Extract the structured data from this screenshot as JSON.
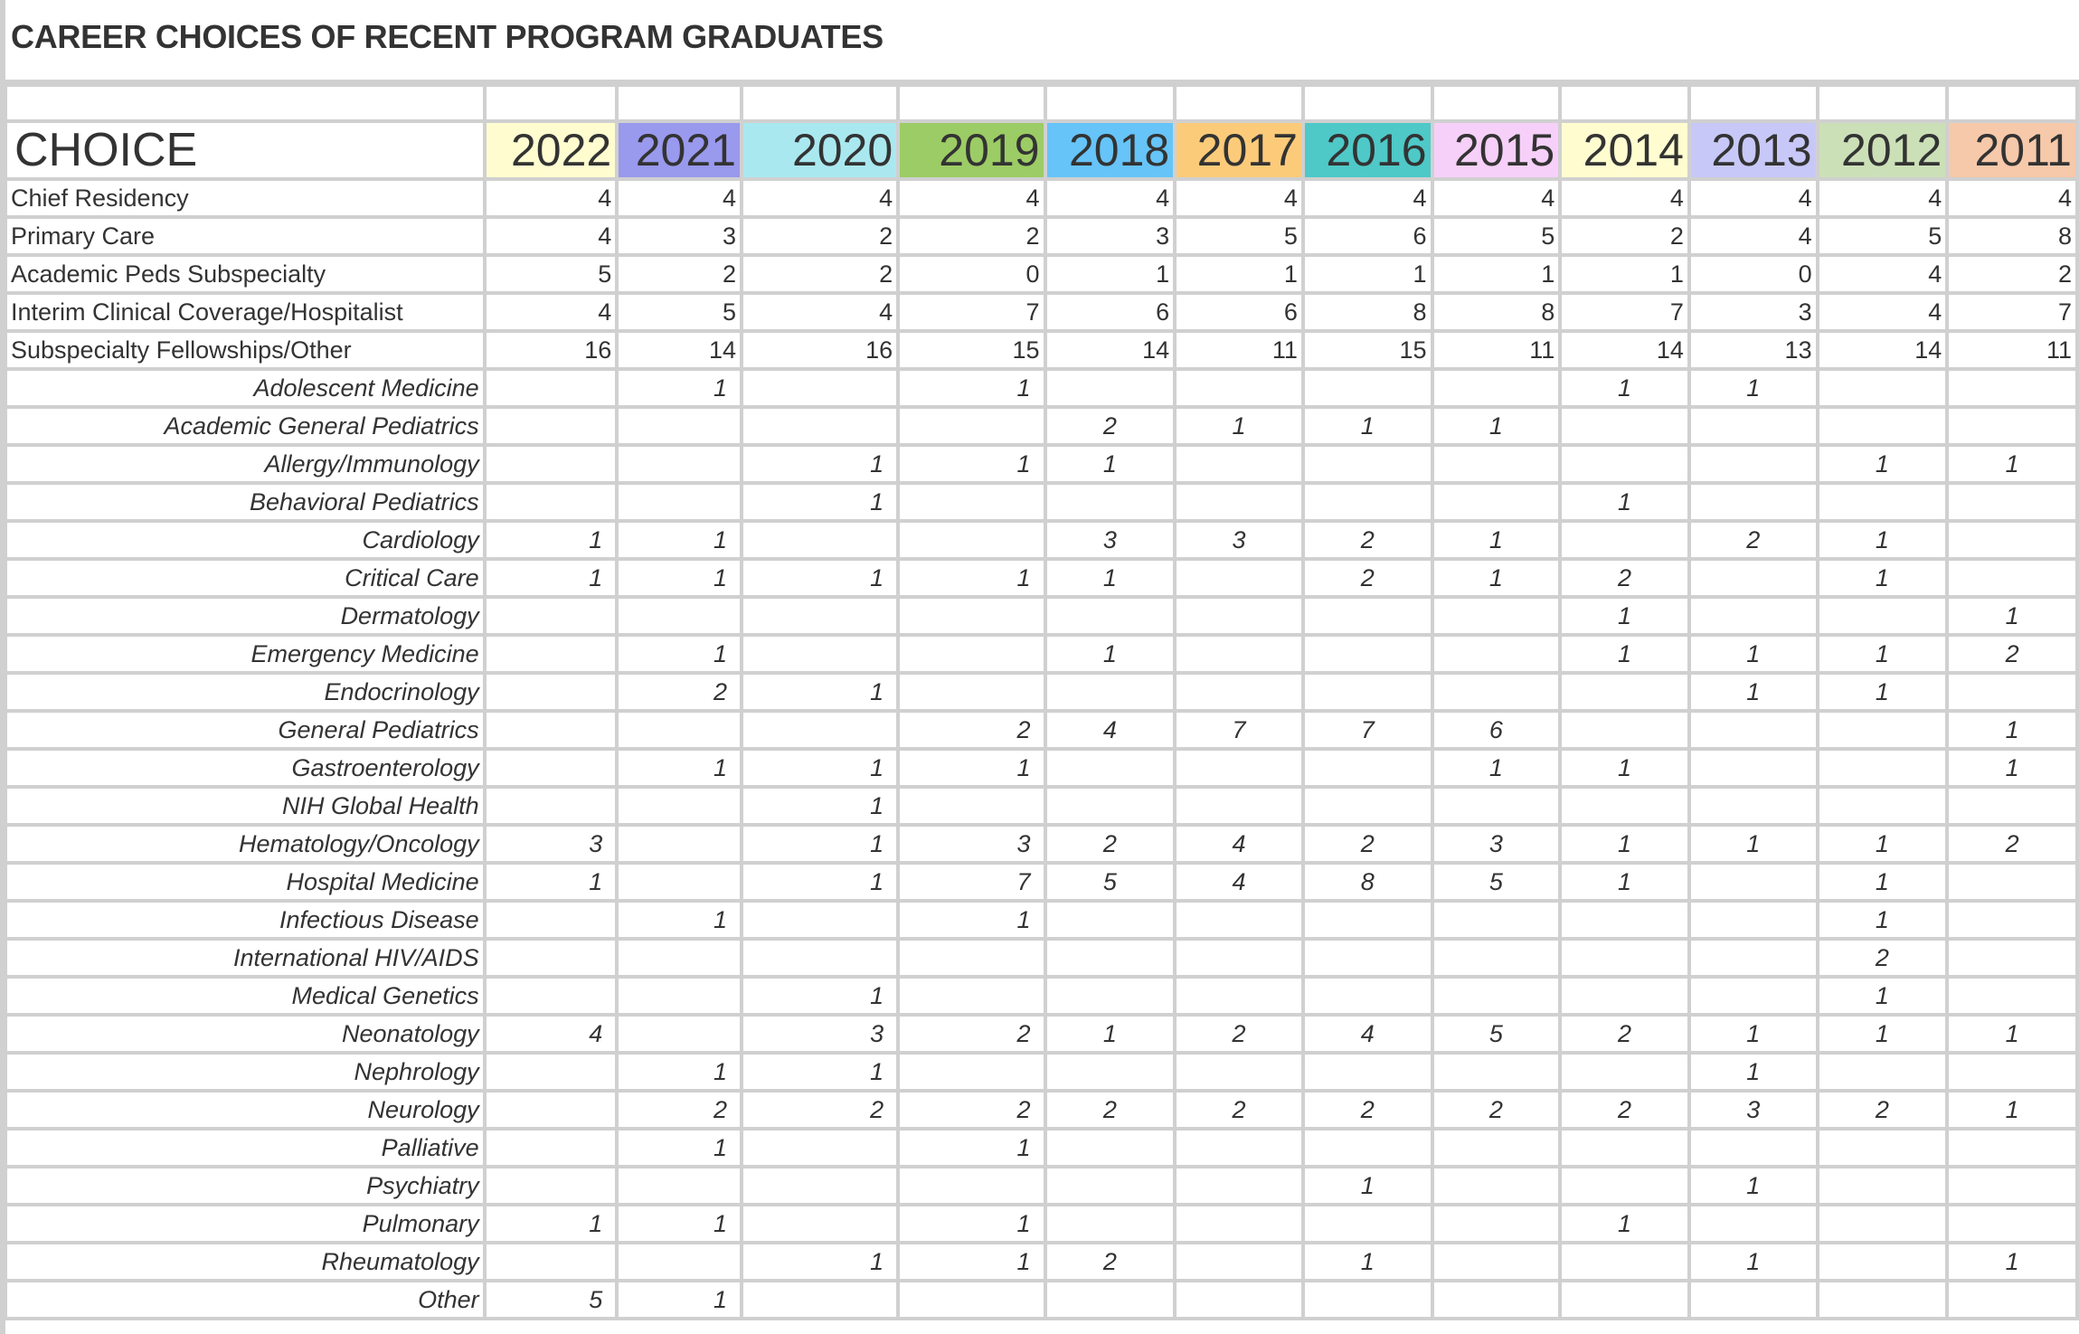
{
  "title": "CAREER CHOICES OF RECENT PROGRAM GRADUATES",
  "header": {
    "choice_label": "CHOICE",
    "years": [
      {
        "label": "2022",
        "color": "#fffdd0"
      },
      {
        "label": "2021",
        "color": "#9999ee"
      },
      {
        "label": "2020",
        "color": "#aae8f0"
      },
      {
        "label": "2019",
        "color": "#9ccc65"
      },
      {
        "label": "2018",
        "color": "#66c4f8"
      },
      {
        "label": "2017",
        "color": "#fccb7a"
      },
      {
        "label": "2016",
        "color": "#4fc8c8"
      },
      {
        "label": "2015",
        "color": "#f6d0f8"
      },
      {
        "label": "2014",
        "color": "#fffdd0"
      },
      {
        "label": "2013",
        "color": "#c8c8f8"
      },
      {
        "label": "2012",
        "color": "#cce0b8"
      },
      {
        "label": "2011",
        "color": "#f6c9aa"
      }
    ]
  },
  "main_rows": [
    {
      "label": "Chief Residency",
      "values": [
        "4",
        "4",
        "4",
        "4",
        "4",
        "4",
        "4",
        "4",
        "4",
        "4",
        "4",
        "4"
      ]
    },
    {
      "label": "Primary Care",
      "values": [
        "4",
        "3",
        "2",
        "2",
        "3",
        "5",
        "6",
        "5",
        "2",
        "4",
        "5",
        "8"
      ]
    },
    {
      "label": "Academic Peds Subspecialty",
      "values": [
        "5",
        "2",
        "2",
        "0",
        "1",
        "1",
        "1",
        "1",
        "1",
        "0",
        "4",
        "2"
      ]
    },
    {
      "label": "Interim Clinical Coverage/Hospitalist",
      "values": [
        "4",
        "5",
        "4",
        "7",
        "6",
        "6",
        "8",
        "8",
        "7",
        "3",
        "4",
        "7"
      ]
    },
    {
      "label": "Subspecialty Fellowships/Other",
      "values": [
        "16",
        "14",
        "16",
        "15",
        "14",
        "11",
        "15",
        "11",
        "14",
        "13",
        "14",
        "11"
      ]
    }
  ],
  "sub_rows": [
    {
      "label": "Adolescent Medicine",
      "values": [
        "",
        "1",
        "",
        "1",
        "",
        "",
        "",
        "",
        "1",
        "1",
        "",
        ""
      ]
    },
    {
      "label": "Academic General Pediatrics",
      "values": [
        "",
        "",
        "",
        "",
        "2",
        "1",
        "1",
        "1",
        "",
        "",
        "",
        ""
      ]
    },
    {
      "label": "Allergy/Immunology",
      "values": [
        "",
        "",
        "1",
        "1",
        "1",
        "",
        "",
        "",
        "",
        "",
        "1",
        "1"
      ]
    },
    {
      "label": "Behavioral Pediatrics",
      "values": [
        "",
        "",
        "1",
        "",
        "",
        "",
        "",
        "",
        "1",
        "",
        "",
        ""
      ]
    },
    {
      "label": "Cardiology",
      "values": [
        "1",
        "1",
        "",
        "",
        "3",
        "3",
        "2",
        "1",
        "",
        "2",
        "1",
        ""
      ]
    },
    {
      "label": "Critical Care",
      "values": [
        "1",
        "1",
        "1",
        "1",
        "1",
        "",
        "2",
        "1",
        "2",
        "",
        "1",
        ""
      ]
    },
    {
      "label": "Dermatology",
      "values": [
        "",
        "",
        "",
        "",
        "",
        "",
        "",
        "",
        "1",
        "",
        "",
        "1"
      ]
    },
    {
      "label": "Emergency Medicine",
      "values": [
        "",
        "1",
        "",
        "",
        "1",
        "",
        "",
        "",
        "1",
        "1",
        "1",
        "2"
      ]
    },
    {
      "label": "Endocrinology",
      "values": [
        "",
        "2",
        "1",
        "",
        "",
        "",
        "",
        "",
        "",
        "1",
        "1",
        ""
      ]
    },
    {
      "label": "General Pediatrics",
      "values": [
        "",
        "",
        "",
        "2",
        "4",
        "7",
        "7",
        "6",
        "",
        "",
        "",
        "1"
      ]
    },
    {
      "label": "Gastroenterology",
      "values": [
        "",
        "1",
        "1",
        "1",
        "",
        "",
        "",
        "1",
        "1",
        "",
        "",
        "1"
      ]
    },
    {
      "label": "NIH Global Health",
      "values": [
        "",
        "",
        "1",
        "",
        "",
        "",
        "",
        "",
        "",
        "",
        "",
        ""
      ]
    },
    {
      "label": "Hematology/Oncology",
      "values": [
        "3",
        "",
        "1",
        "3",
        "2",
        "4",
        "2",
        "3",
        "1",
        "1",
        "1",
        "2"
      ]
    },
    {
      "label": "Hospital Medicine",
      "values": [
        "1",
        "",
        "1",
        "7",
        "5",
        "4",
        "8",
        "5",
        "1",
        "",
        "1",
        ""
      ]
    },
    {
      "label": "Infectious Disease",
      "values": [
        "",
        "1",
        "",
        "1",
        "",
        "",
        "",
        "",
        "",
        "",
        "1",
        ""
      ]
    },
    {
      "label": "International HIV/AIDS",
      "values": [
        "",
        "",
        "",
        "",
        "",
        "",
        "",
        "",
        "",
        "",
        "2",
        ""
      ]
    },
    {
      "label": "Medical Genetics",
      "values": [
        "",
        "",
        "1",
        "",
        "",
        "",
        "",
        "",
        "",
        "",
        "1",
        ""
      ]
    },
    {
      "label": "Neonatology",
      "values": [
        "4",
        "",
        "3",
        "2",
        "1",
        "2",
        "4",
        "5",
        "2",
        "1",
        "1",
        "1"
      ]
    },
    {
      "label": "Nephrology",
      "values": [
        "",
        "1",
        "1",
        "",
        "",
        "",
        "",
        "",
        "",
        "1",
        "",
        ""
      ]
    },
    {
      "label": "Neurology",
      "values": [
        "",
        "2",
        "2",
        "2",
        "2",
        "2",
        "2",
        "2",
        "2",
        "3",
        "2",
        "1"
      ]
    },
    {
      "label": "Palliative",
      "values": [
        "",
        "1",
        "",
        "1",
        "",
        "",
        "",
        "",
        "",
        "",
        "",
        ""
      ]
    },
    {
      "label": "Psychiatry",
      "values": [
        "",
        "",
        "",
        "",
        "",
        "",
        "1",
        "",
        "",
        "1",
        "",
        ""
      ]
    },
    {
      "label": "Pulmonary",
      "values": [
        "1",
        "1",
        "",
        "1",
        "",
        "",
        "",
        "",
        "1",
        "",
        "",
        ""
      ]
    },
    {
      "label": "Rheumatology",
      "values": [
        "",
        "",
        "1",
        "1",
        "2",
        "",
        "1",
        "",
        "",
        "1",
        "",
        "1"
      ]
    },
    {
      "label": "Other",
      "values": [
        "5",
        "1",
        "",
        "",
        "",
        "",
        "",
        "",
        "",
        "",
        "",
        ""
      ]
    }
  ]
}
